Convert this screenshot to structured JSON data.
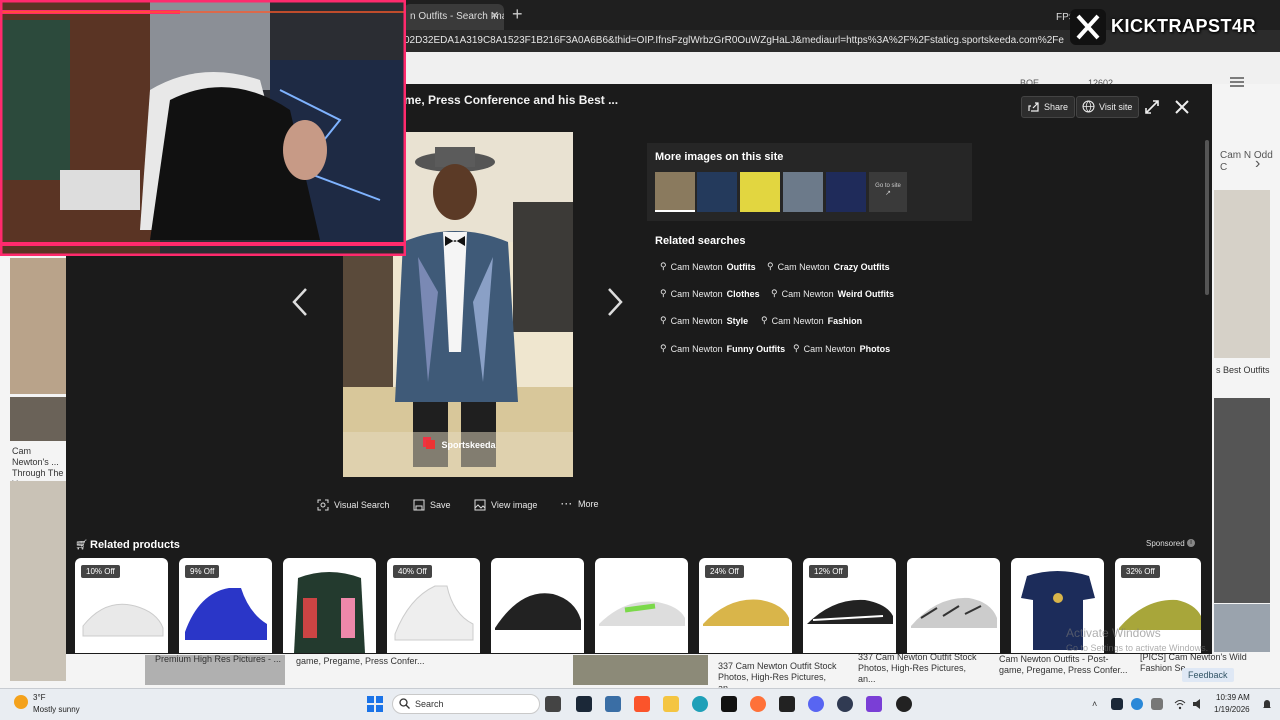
{
  "browser": {
    "tab_title": "n Outfits - Search Imag",
    "tab_close": "✕",
    "new_tab": "+",
    "fps_label": "FPS",
    "url": "02D32EDA1A319C8A1523F1B216F3A0A6B6&thid=OIP.IfnsFzglWrbzGrR0OuWZgHaLJ&mediaurl=https%3A%2F%2Fstaticg.sportskeeda.com%2Feditor%2F2..."
  },
  "background": {
    "left_caption": "Cam Newton's ... Through The Y...",
    "right_caption_1": "Cam N Odd C",
    "right_caption_2": "s Best Outfits",
    "bottom_captions": [
      "Premium High Res Pictures - ...",
      "game, Pregame, Press Confer...",
      "337 Cam Newton Outfit Stock Photos, High-Res Pictures, an...",
      "337 Cam Newton Outfit Stock Photos, High-Res Pictures, an...",
      "Cam Newton Outfits - Post-game, Pregame, Press Confer...",
      "[PICS] Cam Newton's Wild Fashion Se..."
    ],
    "header_count": "12602",
    "header_points": "BOE"
  },
  "viewer": {
    "title": "me, Press Conference and his Best ...",
    "share_label": "Share",
    "visit_label": "Visit site",
    "source_name": "Sportskeeda",
    "actions": {
      "visual_search": "Visual Search",
      "save": "Save",
      "view_image": "View image",
      "more": "More"
    },
    "more_images_heading": "More images on this site",
    "go_to_site": "Go to site",
    "related_heading": "Related searches",
    "related": [
      {
        "prefix": "Cam Newton",
        "bold": "Outfits"
      },
      {
        "prefix": "Cam Newton",
        "bold": "Crazy Outfits"
      },
      {
        "prefix": "Cam Newton",
        "bold": "Clothes"
      },
      {
        "prefix": "Cam Newton",
        "bold": "Weird Outfits"
      },
      {
        "prefix": "Cam Newton",
        "bold": "Style"
      },
      {
        "prefix": "Cam Newton",
        "bold": "Fashion"
      },
      {
        "prefix": "Cam Newton",
        "bold": "Funny Outfits"
      },
      {
        "prefix": "Cam Newton",
        "bold": "Photos"
      }
    ],
    "related_products_heading": "Related products",
    "sponsored": "Sponsored",
    "products": [
      {
        "badge": "10% Off"
      },
      {
        "badge": "9% Off"
      },
      {
        "badge": ""
      },
      {
        "badge": "40% Off"
      },
      {
        "badge": ""
      },
      {
        "badge": ""
      },
      {
        "badge": "24% Off"
      },
      {
        "badge": "12% Off"
      },
      {
        "badge": ""
      },
      {
        "badge": ""
      },
      {
        "badge": "32% Off"
      }
    ]
  },
  "overlay": {
    "brand": "KICKTRAPST4R",
    "activate_title": "Activate Windows",
    "activate_sub": "Go to Settings to activate Windows.",
    "feedback": "Feedback"
  },
  "taskbar": {
    "weather_temp": "3°F",
    "weather_desc": "Mostly sunny",
    "search_label": "Search",
    "time": "10:39 AM",
    "date": "1/19/2026"
  },
  "colors": {
    "modal_bg": "#1b1b1b",
    "webcam_frame": "#ff2a6d",
    "taskbar_bg": "#e9edf2"
  }
}
